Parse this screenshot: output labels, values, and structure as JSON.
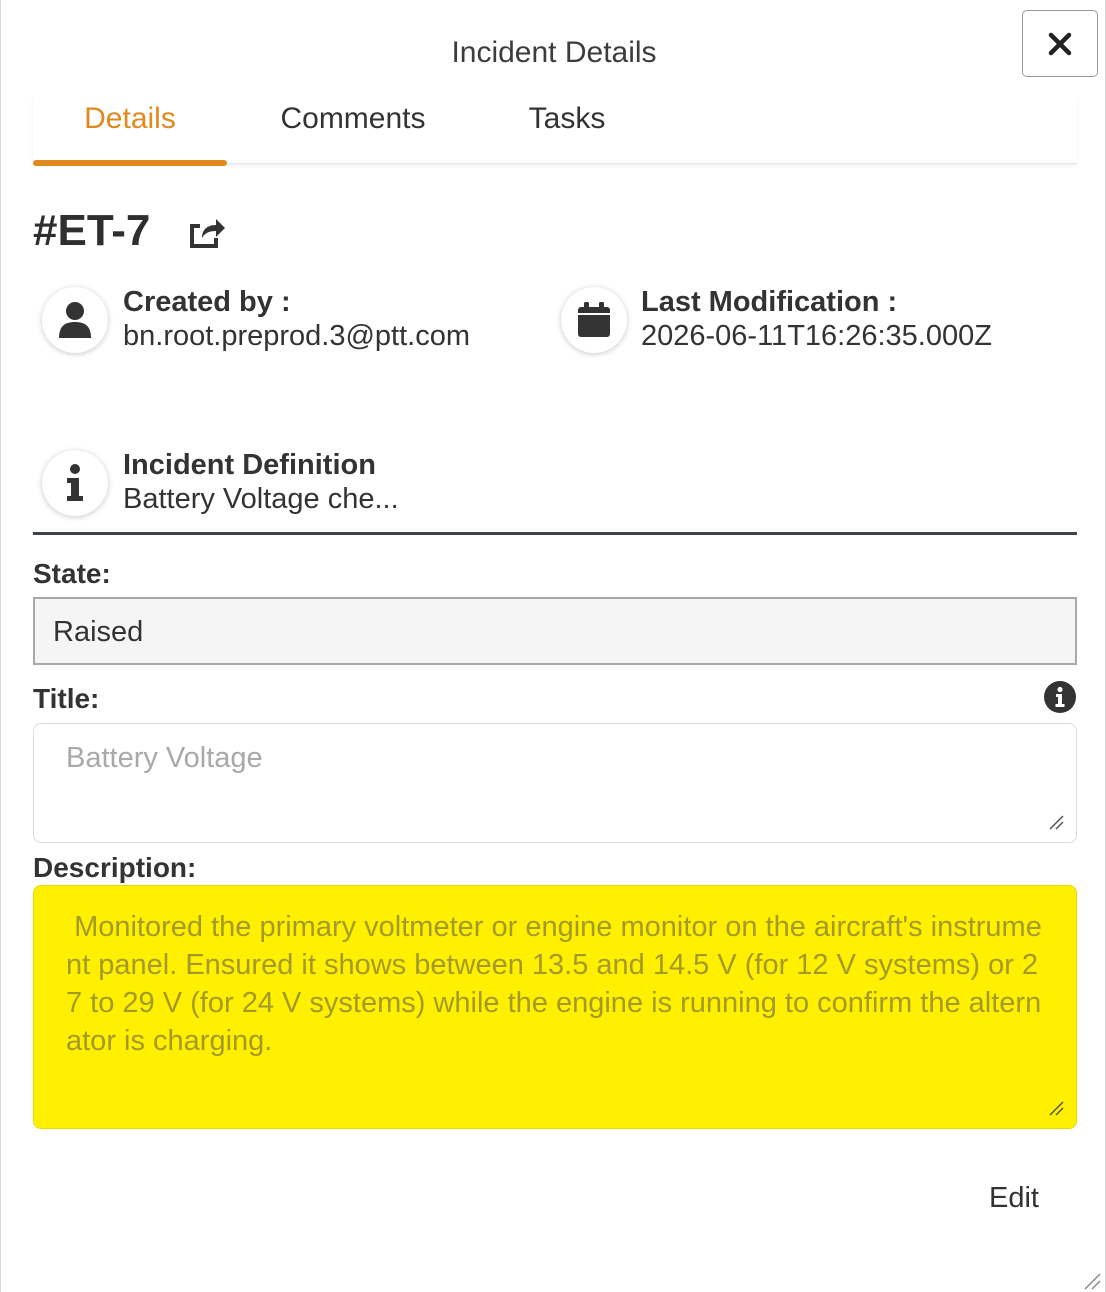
{
  "dialog": {
    "title": "Incident Details",
    "close_label": "close"
  },
  "tabs": [
    {
      "label": "Details",
      "active": true
    },
    {
      "label": "Comments",
      "active": false
    },
    {
      "label": "Tasks",
      "active": false
    }
  ],
  "incident": {
    "id": "#ET-7",
    "created_by_label": "Created by :",
    "created_by_value": "bn.root.preprod.3@ptt.com",
    "last_mod_label": "Last Modification :",
    "last_mod_value": "2026-06-11T16:26:35.000Z",
    "definition_label": "Incident Definition",
    "definition_value": "Battery Voltage che..."
  },
  "form": {
    "state_label": "State:",
    "state_value": "Raised",
    "title_label": "Title:",
    "title_placeholder": "Battery Voltage",
    "description_label": "Description:",
    "description_value": " Monitored the primary voltmeter or engine monitor on the aircraft's instrument panel. Ensured it shows between 13.5 and 14.5 V (for 12 V systems) or 27 to 29 V (for 24 V systems) while the engine is running to confirm the alternator is charging."
  },
  "actions": {
    "edit_label": "Edit"
  },
  "colors": {
    "accent": "#e08a1e",
    "highlight": "#fff000",
    "text": "#333333"
  },
  "icons": {
    "close": "close-icon",
    "share": "share-icon",
    "user": "user-icon",
    "calendar": "calendar-icon",
    "info": "info-icon"
  }
}
